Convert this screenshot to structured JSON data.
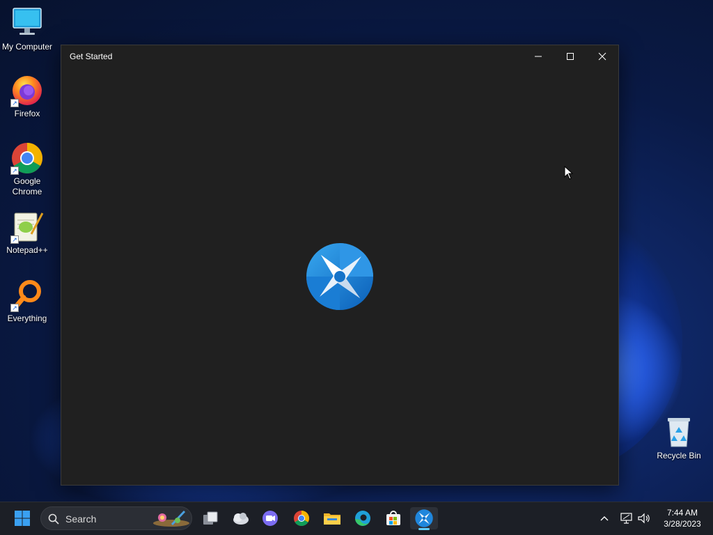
{
  "desktop": {
    "icons": [
      {
        "label": "My Computer",
        "icon": "monitor-icon"
      },
      {
        "label": "Firefox",
        "icon": "firefox-icon"
      },
      {
        "label": "Google Chrome",
        "icon": "chrome-icon"
      },
      {
        "label": "Notepad++",
        "icon": "notepadpp-icon"
      },
      {
        "label": "Everything",
        "icon": "everything-search-icon"
      },
      {
        "label": "Recycle Bin",
        "icon": "recycle-bin-icon"
      }
    ]
  },
  "window": {
    "title": "Get Started",
    "controls": {
      "minimize": "minimize-icon",
      "maximize": "maximize-icon",
      "close": "close-icon"
    },
    "content_icon": "get-started-logo-icon"
  },
  "taskbar": {
    "search_placeholder": "Search",
    "pinned": [
      "start-icon",
      "task-view-icon",
      "widgets-icon",
      "teams-chat-icon",
      "chrome-icon",
      "file-explorer-icon",
      "edge-icon",
      "store-icon",
      "get-started-icon"
    ],
    "active_app": "get-started-icon",
    "tray": [
      "chevron-up-icon",
      "network-icon",
      "volume-icon"
    ],
    "time": "7:44 AM",
    "date": "3/28/2023"
  },
  "colors": {
    "window_bg": "#202020",
    "taskbar_bg": "#1c1f26",
    "accent": "#0078d4",
    "active_indicator": "#60cdff"
  }
}
